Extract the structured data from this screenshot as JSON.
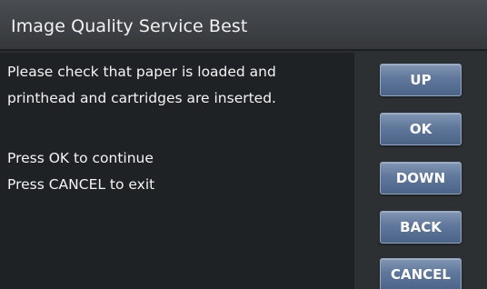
{
  "title": "Image Quality Service Best",
  "message": {
    "line1": "Please check that paper is loaded and",
    "line2": "printhead and cartridges are inserted.",
    "line3": "Press OK to continue",
    "line4": "Press CANCEL to exit"
  },
  "buttons": {
    "up": "UP",
    "ok": "OK",
    "down": "DOWN",
    "back": "BACK",
    "cancel": "CANCEL"
  },
  "colors": {
    "button_blue": "#5f779a",
    "panel_dark": "#1f2224",
    "title_bar": "#3e4246"
  }
}
